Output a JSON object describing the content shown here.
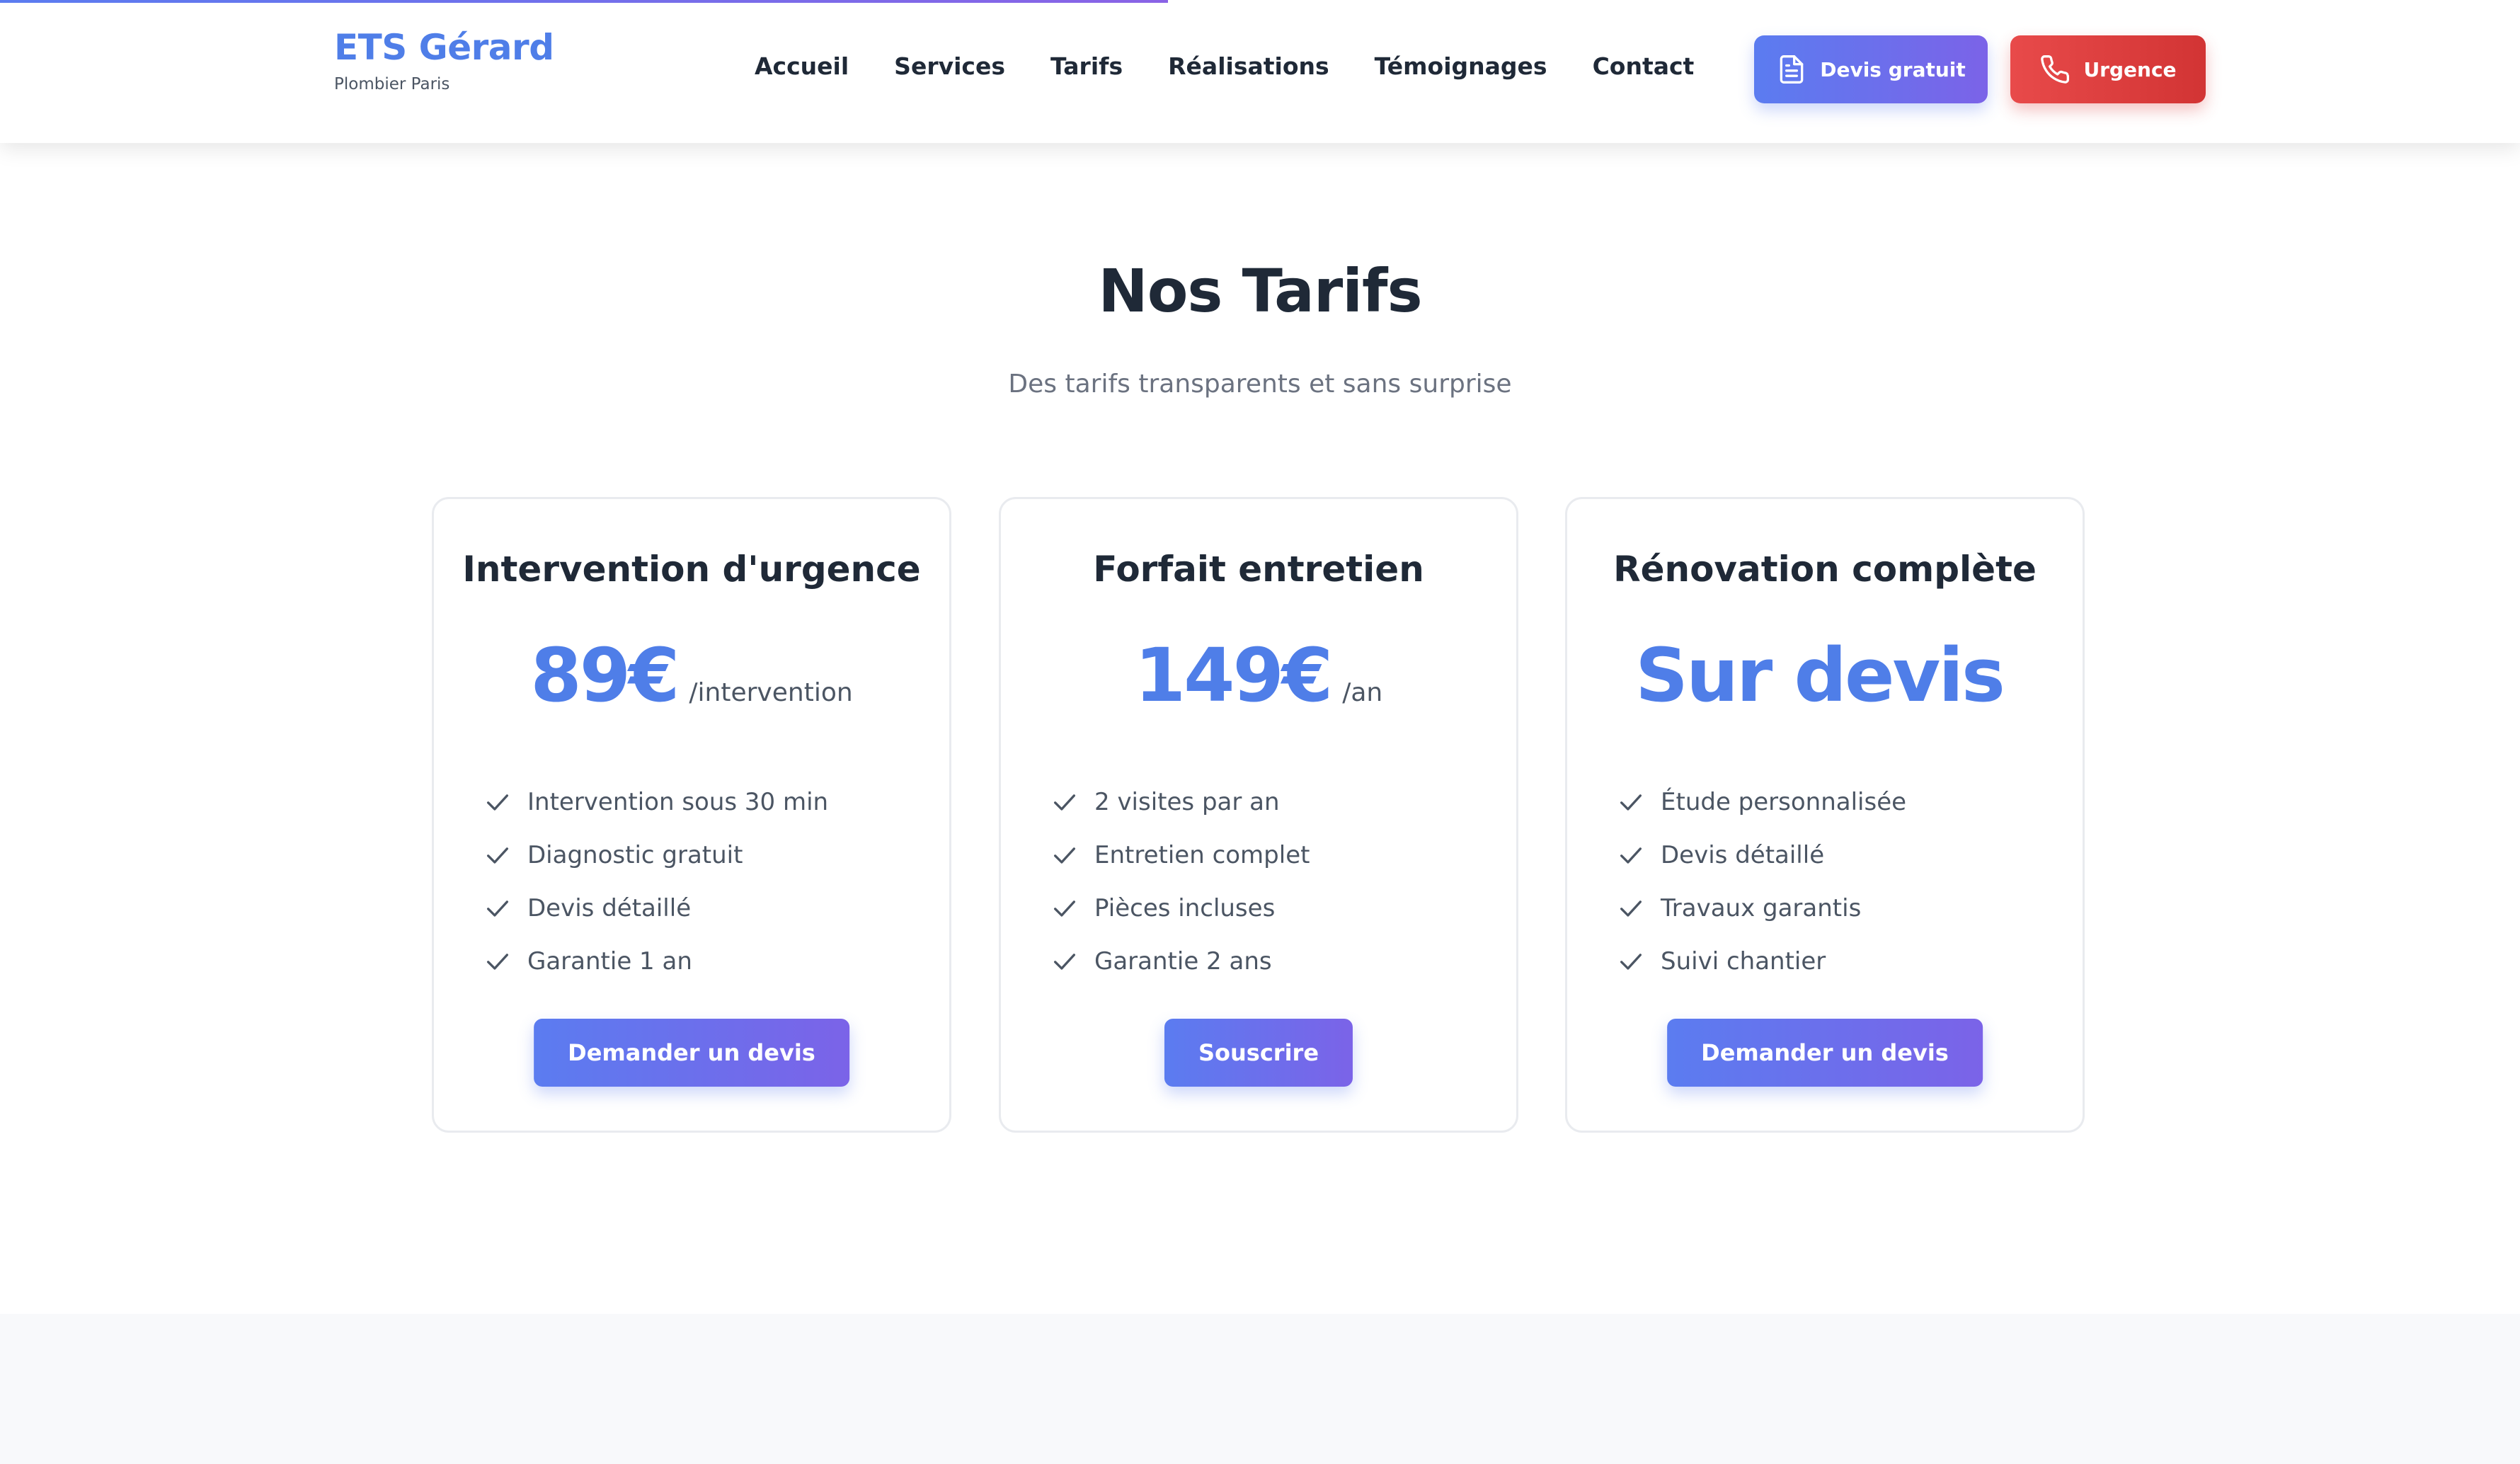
{
  "header": {
    "brand_name": "ETS Gérard",
    "brand_sub": "Plombier Paris",
    "nav": [
      "Accueil",
      "Services",
      "Tarifs",
      "Réalisations",
      "Témoignages",
      "Contact"
    ],
    "devis_label": "Devis gratuit",
    "devis_icon": "document-icon",
    "urgence_label": "Urgence",
    "urgence_icon": "phone-icon"
  },
  "section": {
    "title": "Nos Tarifs",
    "subtitle": "Des tarifs transparents et sans surprise"
  },
  "cards": [
    {
      "title": "Intervention d'urgence",
      "price": "89€",
      "unit": "/intervention",
      "features": [
        "Intervention sous 30 min",
        "Diagnostic gratuit",
        "Devis détaillé",
        "Garantie 1 an"
      ],
      "cta": "Demander un devis"
    },
    {
      "title": "Forfait entretien",
      "price": "149€",
      "unit": "/an",
      "features": [
        "2 visites par an",
        "Entretien complet",
        "Pièces incluses",
        "Garantie 2 ans"
      ],
      "cta": "Souscrire"
    },
    {
      "title": "Rénovation complète",
      "price": "Sur devis",
      "unit": "",
      "features": [
        "Étude personnalisée",
        "Devis détaillé",
        "Travaux garantis",
        "Suivi chantier"
      ],
      "cta": "Demander un devis"
    }
  ],
  "colors": {
    "accent": "#4f7ee8",
    "primary_gradient_start": "#5b7cf0",
    "primary_gradient_end": "#7b63e8",
    "urgent": "#e04040",
    "check_icon": "check-icon"
  }
}
